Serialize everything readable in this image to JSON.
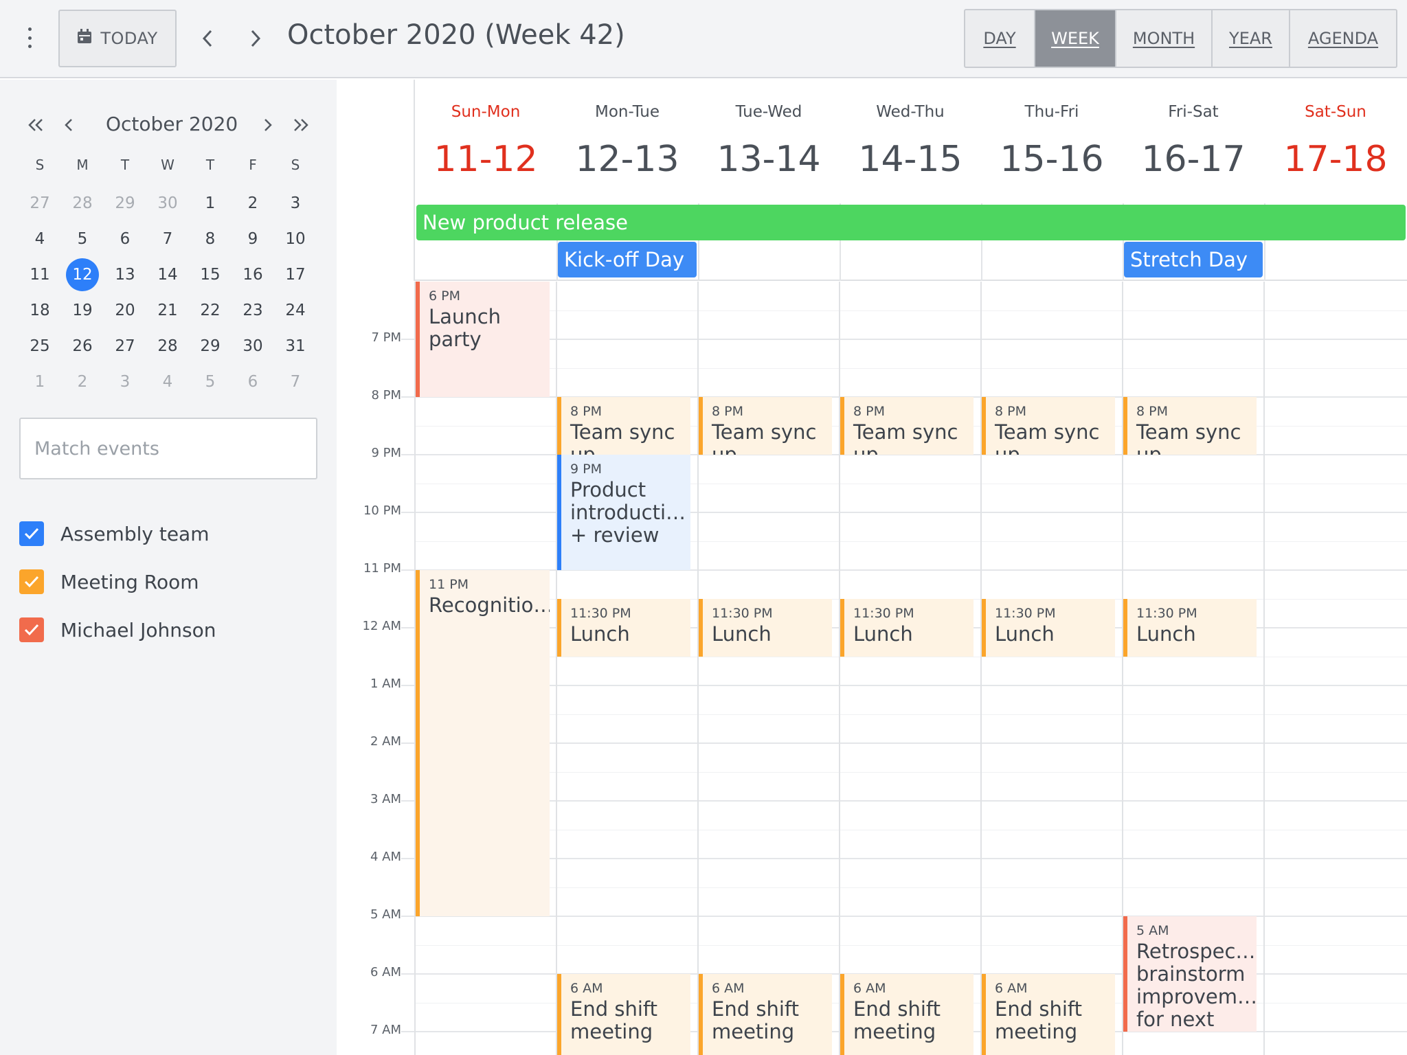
{
  "topbar": {
    "today_label": "TODAY",
    "title": "October 2020 (Week 42)",
    "views": [
      {
        "label": "DAY",
        "active": false
      },
      {
        "label": "WEEK",
        "active": true
      },
      {
        "label": "MONTH",
        "active": false
      },
      {
        "label": "YEAR",
        "active": false
      },
      {
        "label": "AGENDA",
        "active": false
      }
    ]
  },
  "mini_calendar": {
    "title": "October 2020",
    "weekdays": [
      "S",
      "M",
      "T",
      "W",
      "T",
      "F",
      "S"
    ],
    "weeks": [
      [
        "27",
        "28",
        "29",
        "30",
        "1",
        "2",
        "3"
      ],
      [
        "4",
        "5",
        "6",
        "7",
        "8",
        "9",
        "10"
      ],
      [
        "11",
        "12",
        "13",
        "14",
        "15",
        "16",
        "17"
      ],
      [
        "18",
        "19",
        "20",
        "21",
        "22",
        "23",
        "24"
      ],
      [
        "25",
        "26",
        "27",
        "28",
        "29",
        "30",
        "31"
      ],
      [
        "1",
        "2",
        "3",
        "4",
        "5",
        "6",
        "7"
      ]
    ],
    "selected_day": "12"
  },
  "search": {
    "placeholder": "Match events"
  },
  "calendars": [
    {
      "name": "Assembly team",
      "color": "#2d7ff9",
      "checked": true
    },
    {
      "name": "Meeting Room",
      "color": "#fba52b",
      "checked": true
    },
    {
      "name": "Michael Johnson",
      "color": "#f16b4c",
      "checked": true
    }
  ],
  "days": [
    {
      "name": "Sun-Mon",
      "num": "11-12",
      "weekend": true
    },
    {
      "name": "Mon-Tue",
      "num": "12-13",
      "weekend": false
    },
    {
      "name": "Tue-Wed",
      "num": "13-14",
      "weekend": false
    },
    {
      "name": "Wed-Thu",
      "num": "14-15",
      "weekend": false
    },
    {
      "name": "Thu-Fri",
      "num": "15-16",
      "weekend": false
    },
    {
      "name": "Fri-Sat",
      "num": "16-17",
      "weekend": false
    },
    {
      "name": "Sat-Sun",
      "num": "17-18",
      "weekend": true
    }
  ],
  "hours": [
    "7 PM",
    "8 PM",
    "9 PM",
    "10 PM",
    "11 PM",
    "12 AM",
    "1 AM",
    "2 AM",
    "3 AM",
    "4 AM",
    "5 AM",
    "6 AM",
    "7 AM"
  ],
  "allday_events": [
    {
      "title": "New product release",
      "color": "#4dd660"
    },
    {
      "title": "Kick-off Day",
      "color": "#3d8bf5"
    },
    {
      "title": "Stretch Day",
      "color": "#3d8bf5"
    }
  ],
  "events": {
    "launch_party": {
      "time": "6 PM",
      "title": "Launch party"
    },
    "team_sync": {
      "time": "8 PM",
      "title": "Team sync up"
    },
    "product_intro": {
      "time": "9 PM",
      "title": "Product introducti… + review"
    },
    "recognition": {
      "time": "11 PM",
      "title": "Recognitio…"
    },
    "lunch": {
      "time": "11:30 PM",
      "title": "Lunch"
    },
    "retrospective": {
      "time": "5 AM",
      "title": "Retrospec… brainstorm improvem… for next"
    },
    "end_shift": {
      "time": "6 AM",
      "title": "End shift meeting"
    }
  }
}
